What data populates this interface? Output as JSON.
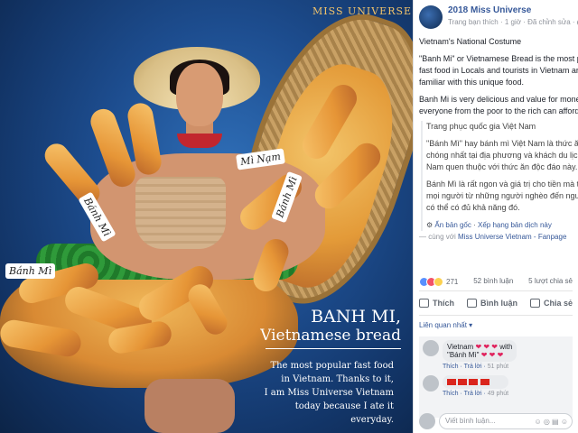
{
  "photo": {
    "logo": "MISS UNIVERSE",
    "tags": [
      "Bánh Mì",
      "Mì Nạm",
      "Bánh Mì",
      "Bánh Mì"
    ],
    "headline_line1": "BANH MI,",
    "headline_line2": "Vietnamese bread",
    "caption_lines": [
      "The most popular fast food",
      "in Vietnam. Thanks to it,",
      "I am Miss Universe Vietnam",
      "today because I ate it everyday."
    ]
  },
  "post": {
    "page_name": "2018 Miss Universe",
    "meta": "Trang bạn thích · 1 giờ · Đã chỉnh sửa ·",
    "body": [
      "Vietnam's National Costume",
      "\"Banh Mi\" or Vietnamese Bread is the most popular",
      "fast food in Locals and tourists in Vietnam are",
      "familiar with this unique food.",
      "Banh Mi is very delicious and value for money",
      "everyone from the poor to the rich can afford it."
    ],
    "translation": [
      "Trang phục quốc gia Việt Nam",
      "\"Bánh Mì\" hay bánh mì Việt Nam là thức ăn nhanh",
      "chóng nhất tại địa phương và khách du lịch ở Việt",
      "Nam quen thuộc với thức ăn độc đáo này.",
      "Bánh Mì là rất ngon và giá trị cho tiền mà tất cả",
      "mọi người từ những người nghèo đến người giàu đều",
      "có thể có đủ khả năng đó."
    ],
    "translation_hide": "Ẩn bản gốc",
    "translation_rate": "Xếp hạng bản dịch này",
    "with_prefix": "— cùng với ",
    "with_page": "Miss Universe Vietnam - Fanpage"
  },
  "stats": {
    "reactions": "271",
    "comments": "52 bình luận",
    "shares": "5 lượt chia sẻ"
  },
  "actions": {
    "like": "Thích",
    "comment": "Bình luận",
    "share": "Chia sẻ"
  },
  "sort_label": "Liên quan nhất ▾",
  "comments": [
    {
      "text": "Vietnam",
      "hearts": "❤ ❤ ❤",
      "suffix": " with",
      "line2": "\"Bánh Mì\"",
      "hearts2": "❤ ❤ ❤",
      "like": "Thích",
      "reply": "Trả lời",
      "time": "51 phút"
    },
    {
      "text": "",
      "like": "Thích",
      "reply": "Trả lời",
      "time": "49 phút"
    }
  ],
  "write": {
    "placeholder": "Viết bình luận...",
    "icons": "☺ ◎ ▤ ☺"
  }
}
